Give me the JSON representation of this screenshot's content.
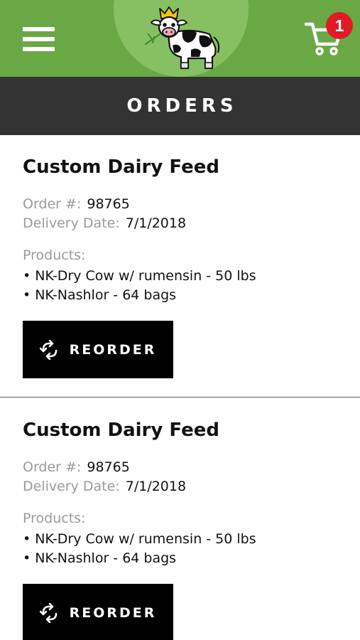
{
  "header": {
    "menu_icon": "hamburger-menu-icon",
    "logo_icon": "crowned-cow-logo",
    "cart_icon": "shopping-cart-icon",
    "cart_count": "1",
    "brand_colors": {
      "header_green": "#69a845",
      "logo_circle": "#86c063",
      "badge_red": "#e01b24"
    }
  },
  "page": {
    "title": "ORDERS",
    "title_bar_color": "#333333"
  },
  "orders": [
    {
      "title": "Custom Dairy Feed",
      "order_number_label": "Order #:",
      "order_number": "98765",
      "delivery_date_label": "Delivery Date:",
      "delivery_date": "7/1/2018",
      "products_label": "Products:",
      "products": [
        "NK-Dry Cow w/ rumensin - 50 lbs",
        "NK-Nashlor - 64 bags"
      ],
      "reorder_label": "REORDER",
      "reorder_icon": "refresh-arrows-icon"
    },
    {
      "title": "Custom Dairy Feed",
      "order_number_label": "Order #:",
      "order_number": "98765",
      "delivery_date_label": "Delivery Date:",
      "delivery_date": "7/1/2018",
      "products_label": "Products:",
      "products": [
        "NK-Dry Cow w/ rumensin - 50 lbs",
        "NK-Nashlor - 64 bags"
      ],
      "reorder_label": "REORDER",
      "reorder_icon": "refresh-arrows-icon"
    }
  ]
}
